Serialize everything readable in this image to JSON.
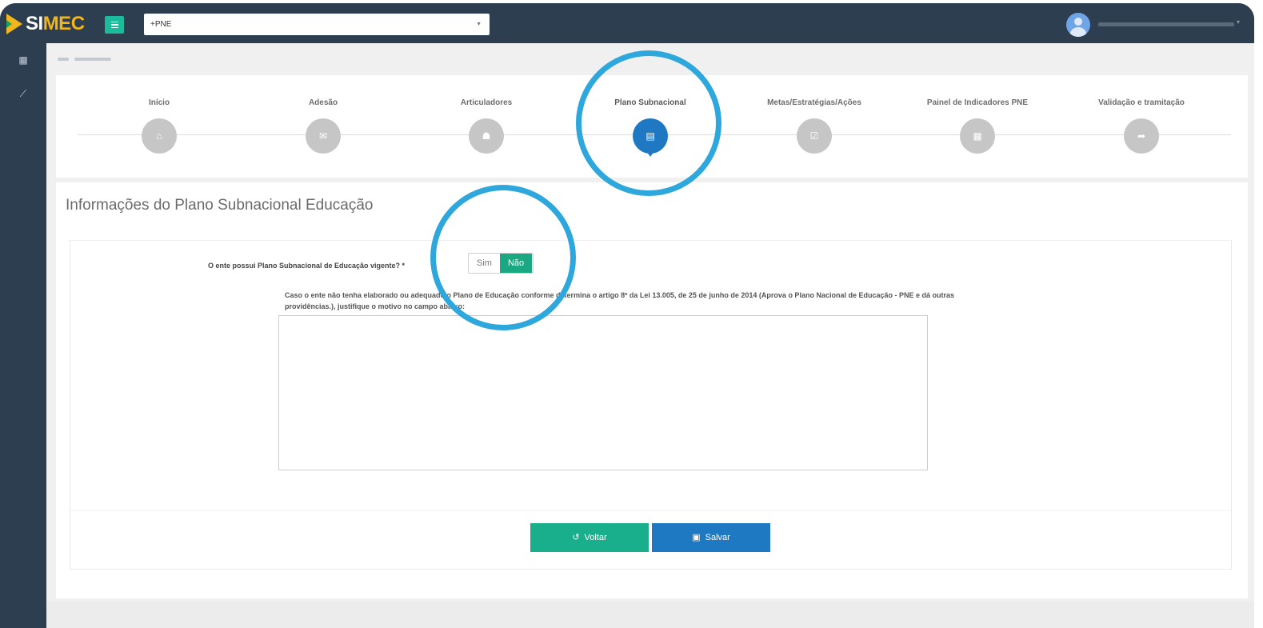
{
  "app": {
    "logo_prefix": "SI",
    "logo_suffix": "MEC",
    "system_select_value": "+PNE"
  },
  "wizard": {
    "steps": [
      {
        "label": "Início",
        "icon": "home-icon",
        "glyph": "⌂"
      },
      {
        "label": "Adesão",
        "icon": "handshake-icon",
        "glyph": "✉"
      },
      {
        "label": "Articuladores",
        "icon": "users-icon",
        "glyph": "☗"
      },
      {
        "label": "Plano Subnacional",
        "icon": "document-icon",
        "glyph": "▤"
      },
      {
        "label": "Metas/Estratégias/Ações",
        "icon": "checklist-icon",
        "glyph": "☑"
      },
      {
        "label": "Painel de Indicadores PNE",
        "icon": "chart-icon",
        "glyph": "▦"
      },
      {
        "label": "Validação e tramitação",
        "icon": "share-icon",
        "glyph": "➦"
      }
    ],
    "active_step": "Plano Subnacional"
  },
  "panel": {
    "title": "Informações do Plano Subnacional Educação",
    "question_label": "O ente possui Plano Subnacional de Educação vigente? *",
    "toggle_yes": "Sim",
    "toggle_no": "Não",
    "toggle_selected": "Não",
    "hint_text": "Caso o ente não tenha elaborado ou adequado o Plano de Educação conforme determina o artigo 8º da Lei 13.005, de 25 de junho de 2014 (Aprova o Plano Nacional de Educação - PNE e dá outras providências.), justifique o motivo no campo abaixo:",
    "justification_value": "",
    "back_label": "Voltar",
    "save_label": "Salvar"
  },
  "colors": {
    "header_bg": "#2c3e50",
    "accent_green": "#1aa883",
    "accent_blue": "#1e79c2",
    "highlight_ring": "#2ea7dc"
  }
}
